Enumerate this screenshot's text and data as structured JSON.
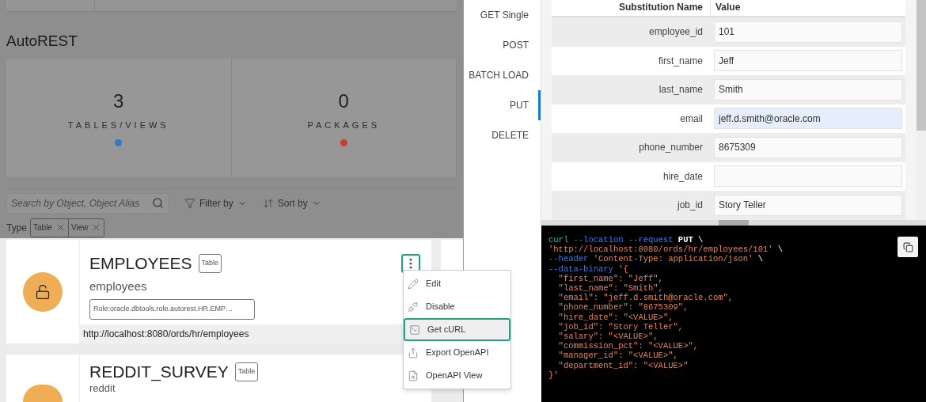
{
  "page": {
    "title": "AutoREST",
    "stats": [
      {
        "value": "3",
        "label": "TABLES/VIEWS",
        "color": "#2f7bc4"
      },
      {
        "value": "0",
        "label": "PACKAGES",
        "color": "#c8402a"
      }
    ],
    "search": {
      "placeholder": "Search by Object, Object Alias"
    },
    "filter_button": "Filter by",
    "sort_button": "Sort by",
    "type_filter": {
      "label": "Type",
      "chips": [
        "Table",
        "View"
      ]
    },
    "objects": [
      {
        "name": "EMPLOYEES",
        "type": "Table",
        "alias": "employees",
        "role": "Role:oracle.dbtools.role.autorest.HR.EMP…",
        "url": "http://localhost:8080/ords/hr/employees",
        "menu_open": true
      },
      {
        "name": "REDDIT_SURVEY",
        "type": "Table",
        "alias": "reddit"
      }
    ],
    "menu": [
      {
        "label": "Edit",
        "kind": "pencil",
        "selected": false
      },
      {
        "label": "Disable",
        "kind": "unplug",
        "selected": false
      },
      {
        "label": "Get cURL",
        "kind": "terminal",
        "selected": true
      },
      {
        "label": "Export OpenAPI",
        "kind": "export",
        "selected": false
      },
      {
        "label": "OpenAPI View",
        "kind": "view",
        "selected": false
      }
    ]
  },
  "methods": [
    {
      "label": "GET Single",
      "selected": false
    },
    {
      "label": "POST",
      "selected": false
    },
    {
      "label": "BATCH LOAD",
      "selected": false
    },
    {
      "label": "PUT",
      "selected": true
    },
    {
      "label": "DELETE",
      "selected": false
    }
  ],
  "substitutions": {
    "columns": [
      "Substitution Name",
      "Value"
    ],
    "rows": [
      {
        "name": "employee_id",
        "value": "101",
        "focused": false
      },
      {
        "name": "first_name",
        "value": "Jeff",
        "focused": false
      },
      {
        "name": "last_name",
        "value": "Smith",
        "focused": false
      },
      {
        "name": "email",
        "value": "jeff.d.smith@oracle.com",
        "focused": true
      },
      {
        "name": "phone_number",
        "value": "8675309",
        "focused": false
      },
      {
        "name": "hire_date",
        "value": "",
        "focused": false
      },
      {
        "name": "job_id",
        "value": "Story Teller",
        "focused": false
      }
    ]
  },
  "curl": [
    [
      {
        "kind": "command",
        "text": "curl"
      },
      {
        "kind": "flag",
        "text": " --location --request "
      },
      {
        "kind": "keyword",
        "text": "PUT"
      },
      {
        "kind": "plain",
        "text": " \\"
      }
    ],
    [
      {
        "kind": "string",
        "text": "'http://localhost:8080/ords/hr/employees/101'"
      },
      {
        "kind": "plain",
        "text": " \\"
      }
    ],
    [
      {
        "kind": "flag",
        "text": "--header "
      },
      {
        "kind": "string",
        "text": "'Content-Type: application/json'"
      },
      {
        "kind": "plain",
        "text": " \\"
      }
    ],
    [
      {
        "kind": "flag",
        "text": "--data-binary "
      },
      {
        "kind": "string",
        "text": "'{"
      }
    ],
    [
      {
        "kind": "string",
        "text": "  \"first_name\": \"Jeff\","
      }
    ],
    [
      {
        "kind": "string",
        "text": "  \"last_name\": \"Smith\","
      }
    ],
    [
      {
        "kind": "string",
        "text": "  \"email\": \"jeff.d.smith@oracle.com\","
      }
    ],
    [
      {
        "kind": "string",
        "text": "  \"phone_number\": \"8675309\","
      }
    ],
    [
      {
        "kind": "string",
        "text": "  \"hire_date\": \"<VALUE>\","
      }
    ],
    [
      {
        "kind": "string",
        "text": "  \"job_id\": \"Story Teller\","
      }
    ],
    [
      {
        "kind": "string",
        "text": "  \"salary\": \"<VALUE>\","
      }
    ],
    [
      {
        "kind": "string",
        "text": "  \"commission_pct\": \"<VALUE>\","
      }
    ],
    [
      {
        "kind": "string",
        "text": "  \"manager_id\": \"<VALUE>\","
      }
    ],
    [
      {
        "kind": "string",
        "text": "  \"department_id\": \"<VALUE>\""
      }
    ],
    [
      {
        "kind": "string",
        "text": "}'"
      }
    ]
  ]
}
